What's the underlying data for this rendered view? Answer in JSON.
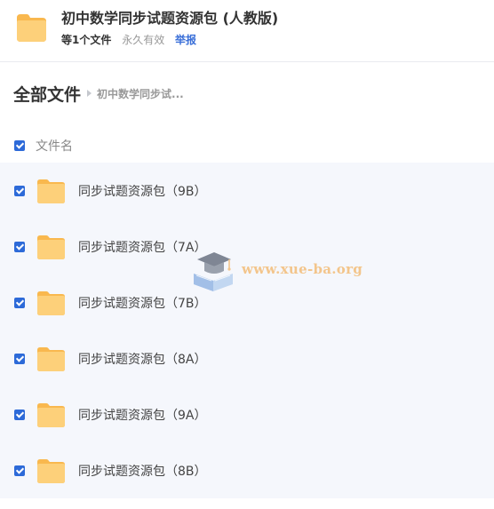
{
  "share": {
    "title": "初中数学同步试题资源包 (人教版)",
    "file_count": "等1个文件",
    "validity": "永久有效",
    "report_label": "举报",
    "icon": "folder-icon"
  },
  "breadcrumb": {
    "root": "全部文件",
    "current": "初中数学同步试..."
  },
  "list": {
    "header_label": "文件名",
    "select_all_checked": true,
    "files": [
      {
        "name": "同步试题资源包（9B）",
        "checked": true,
        "icon": "folder-icon"
      },
      {
        "name": "同步试题资源包（7A）",
        "checked": true,
        "icon": "folder-icon"
      },
      {
        "name": "同步试题资源包（7B）",
        "checked": true,
        "icon": "folder-icon"
      },
      {
        "name": "同步试题资源包（8A）",
        "checked": true,
        "icon": "folder-icon"
      },
      {
        "name": "同步试题资源包（9A）",
        "checked": true,
        "icon": "folder-icon"
      },
      {
        "name": "同步试题资源包（8B）",
        "checked": true,
        "icon": "folder-icon"
      }
    ]
  },
  "watermark": {
    "text": "www.xue-ba.org",
    "icon": "graduation-cap-book-logo"
  },
  "colors": {
    "accent": "#2d6ad8",
    "link": "#3a6fd8",
    "folder": "#fcc96a",
    "list_background": "#f5f7fc",
    "watermark_text": "#f3c58b"
  }
}
